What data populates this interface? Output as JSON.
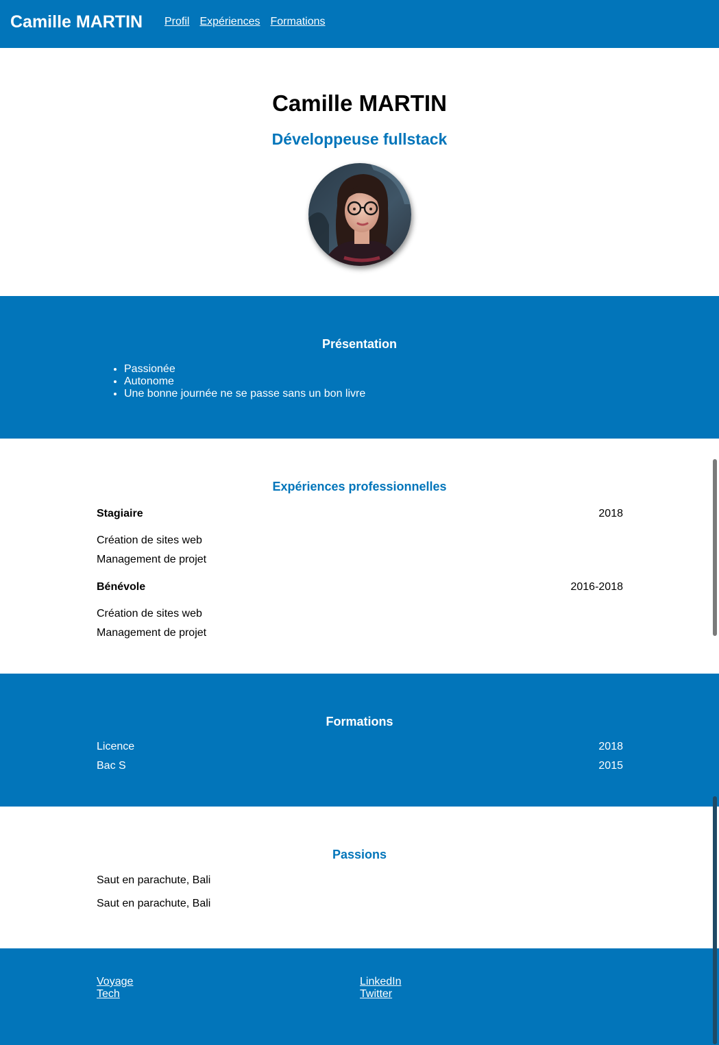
{
  "nav": {
    "brand": "Camille MARTIN",
    "links": [
      "Profil",
      "Expériences",
      "Formations"
    ]
  },
  "hero": {
    "name": "Camille MARTIN",
    "job": "Développeuse fullstack"
  },
  "presentation": {
    "title": "Présentation",
    "items": [
      "Passionée",
      "Autonome",
      "Une bonne journée ne se passe sans un bon livre"
    ]
  },
  "experiences": {
    "title": "Expériences professionnelles",
    "items": [
      {
        "role": "Stagiaire",
        "date": "2018",
        "tasks": [
          "Création de sites web",
          "Management de projet"
        ]
      },
      {
        "role": "Bénévole",
        "date": "2016-2018",
        "tasks": [
          "Création de sites web",
          "Management de projet"
        ]
      }
    ]
  },
  "formations": {
    "title": "Formations",
    "items": [
      {
        "label": "Licence",
        "date": "2018"
      },
      {
        "label": "Bac S",
        "date": "2015"
      }
    ]
  },
  "passions": {
    "title": "Passions",
    "items": [
      "Saut en parachute, Bali",
      "Saut en parachute, Bali"
    ]
  },
  "footer": {
    "col1": [
      "Voyage",
      "Tech"
    ],
    "col2": [
      "LinkedIn",
      "Twitter"
    ]
  },
  "colors": {
    "primary": "#0275ba",
    "white": "#ffffff"
  }
}
